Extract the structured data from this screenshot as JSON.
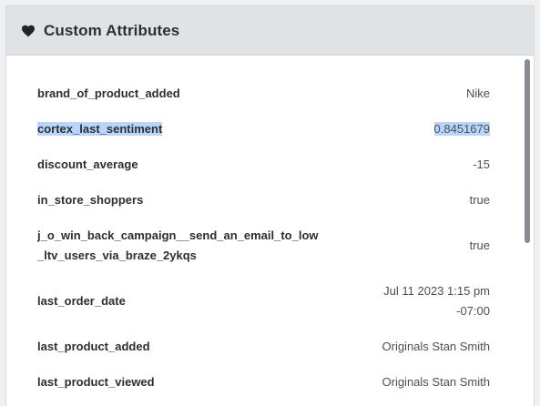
{
  "panel": {
    "title": "Custom Attributes",
    "icon": "heart-icon"
  },
  "attributes": [
    {
      "key": "brand_of_product_added",
      "value": [
        "Nike"
      ],
      "selected": false
    },
    {
      "key": "cortex_last_sentiment",
      "value": [
        "0.8451679"
      ],
      "selected": true
    },
    {
      "key": "discount_average",
      "value": [
        "-15"
      ],
      "selected": false
    },
    {
      "key": "in_store_shoppers",
      "value": [
        "true"
      ],
      "selected": false
    },
    {
      "key": [
        "j_o_win_back_campaign__send_an_email_to_low",
        "_ltv_users_via_braze_2ykqs"
      ],
      "value": [
        "true"
      ],
      "selected": false
    },
    {
      "key": "last_order_date",
      "value": [
        "Jul 11 2023 1:15 pm",
        "-07:00"
      ],
      "selected": false
    },
    {
      "key": "last_product_added",
      "value": [
        "Originals Stan Smith"
      ],
      "selected": false
    },
    {
      "key": "last_product_viewed",
      "value": [
        "Originals Stan Smith"
      ],
      "selected": false
    }
  ],
  "colors": {
    "header_bg": "#dfe3e5",
    "selection": "#b9d5fb",
    "text": "#2b2f33"
  }
}
